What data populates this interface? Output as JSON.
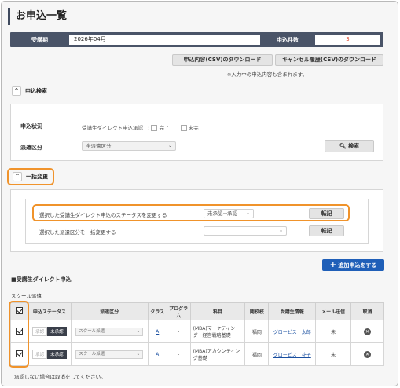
{
  "page": {
    "title": "お申込一覧"
  },
  "infobar": {
    "period_label": "受講期",
    "period_value": "2026年04月",
    "count_label": "申込件数",
    "count_value": "3"
  },
  "downloads": {
    "csv_button": "申込内容(CSV)のダウンロード",
    "cancel_csv_button": "キャンセル履歴(CSV)のダウンロード",
    "note": "※入力中の申込内容も含まれます。"
  },
  "search": {
    "section_title": "申込検索",
    "status_label": "申込状況",
    "status_text": "受講生ダイレクト申込承認",
    "opt_done": "完了",
    "opt_pending": "未完",
    "dispatch_label": "派遣区分",
    "dispatch_value": "全派遣区分",
    "search_button": "検索"
  },
  "bulk": {
    "section_title": "一括変更",
    "row1_text": "選択した受講生ダイレクト申込のステータスを変更する",
    "row1_value": "未承認→承認",
    "row1_button": "転記",
    "row2_text": "選択した派遣区分を一括変更する",
    "row2_value": "",
    "row2_button": "転記"
  },
  "add_button": "追加申込をする",
  "direct": {
    "section_title": "■受講生ダイレクト申込",
    "subtitle": "スクール派遣",
    "columns": [
      "申込ステータス",
      "派遣区分",
      "クラス",
      "プログラム",
      "科目",
      "開校校",
      "受講生情報",
      "メール送信",
      "取消"
    ],
    "rows": [
      {
        "approved": "承認",
        "unapproved": "未承認",
        "dispatch": "スクール派遣",
        "class": "A",
        "program": "-",
        "subject": "(MBA)マーケティング・経営戦略基礎",
        "school": "福岡",
        "student": "グロービス　太郎",
        "mail": "未"
      },
      {
        "approved": "承認",
        "unapproved": "未承認",
        "dispatch": "スクール派遣",
        "class": "A",
        "program": "-",
        "subject": "(MBA)アカウンティング基礎",
        "school": "福岡",
        "student": "グロービス　花子",
        "mail": "未"
      }
    ],
    "footer_note": "承認しない場合は取消をしてください。"
  },
  "colors": {
    "header_bar": "#4a5468",
    "accent_orange": "#f0932b",
    "primary_blue": "#1f5fb8",
    "count_red": "#e0452b"
  }
}
